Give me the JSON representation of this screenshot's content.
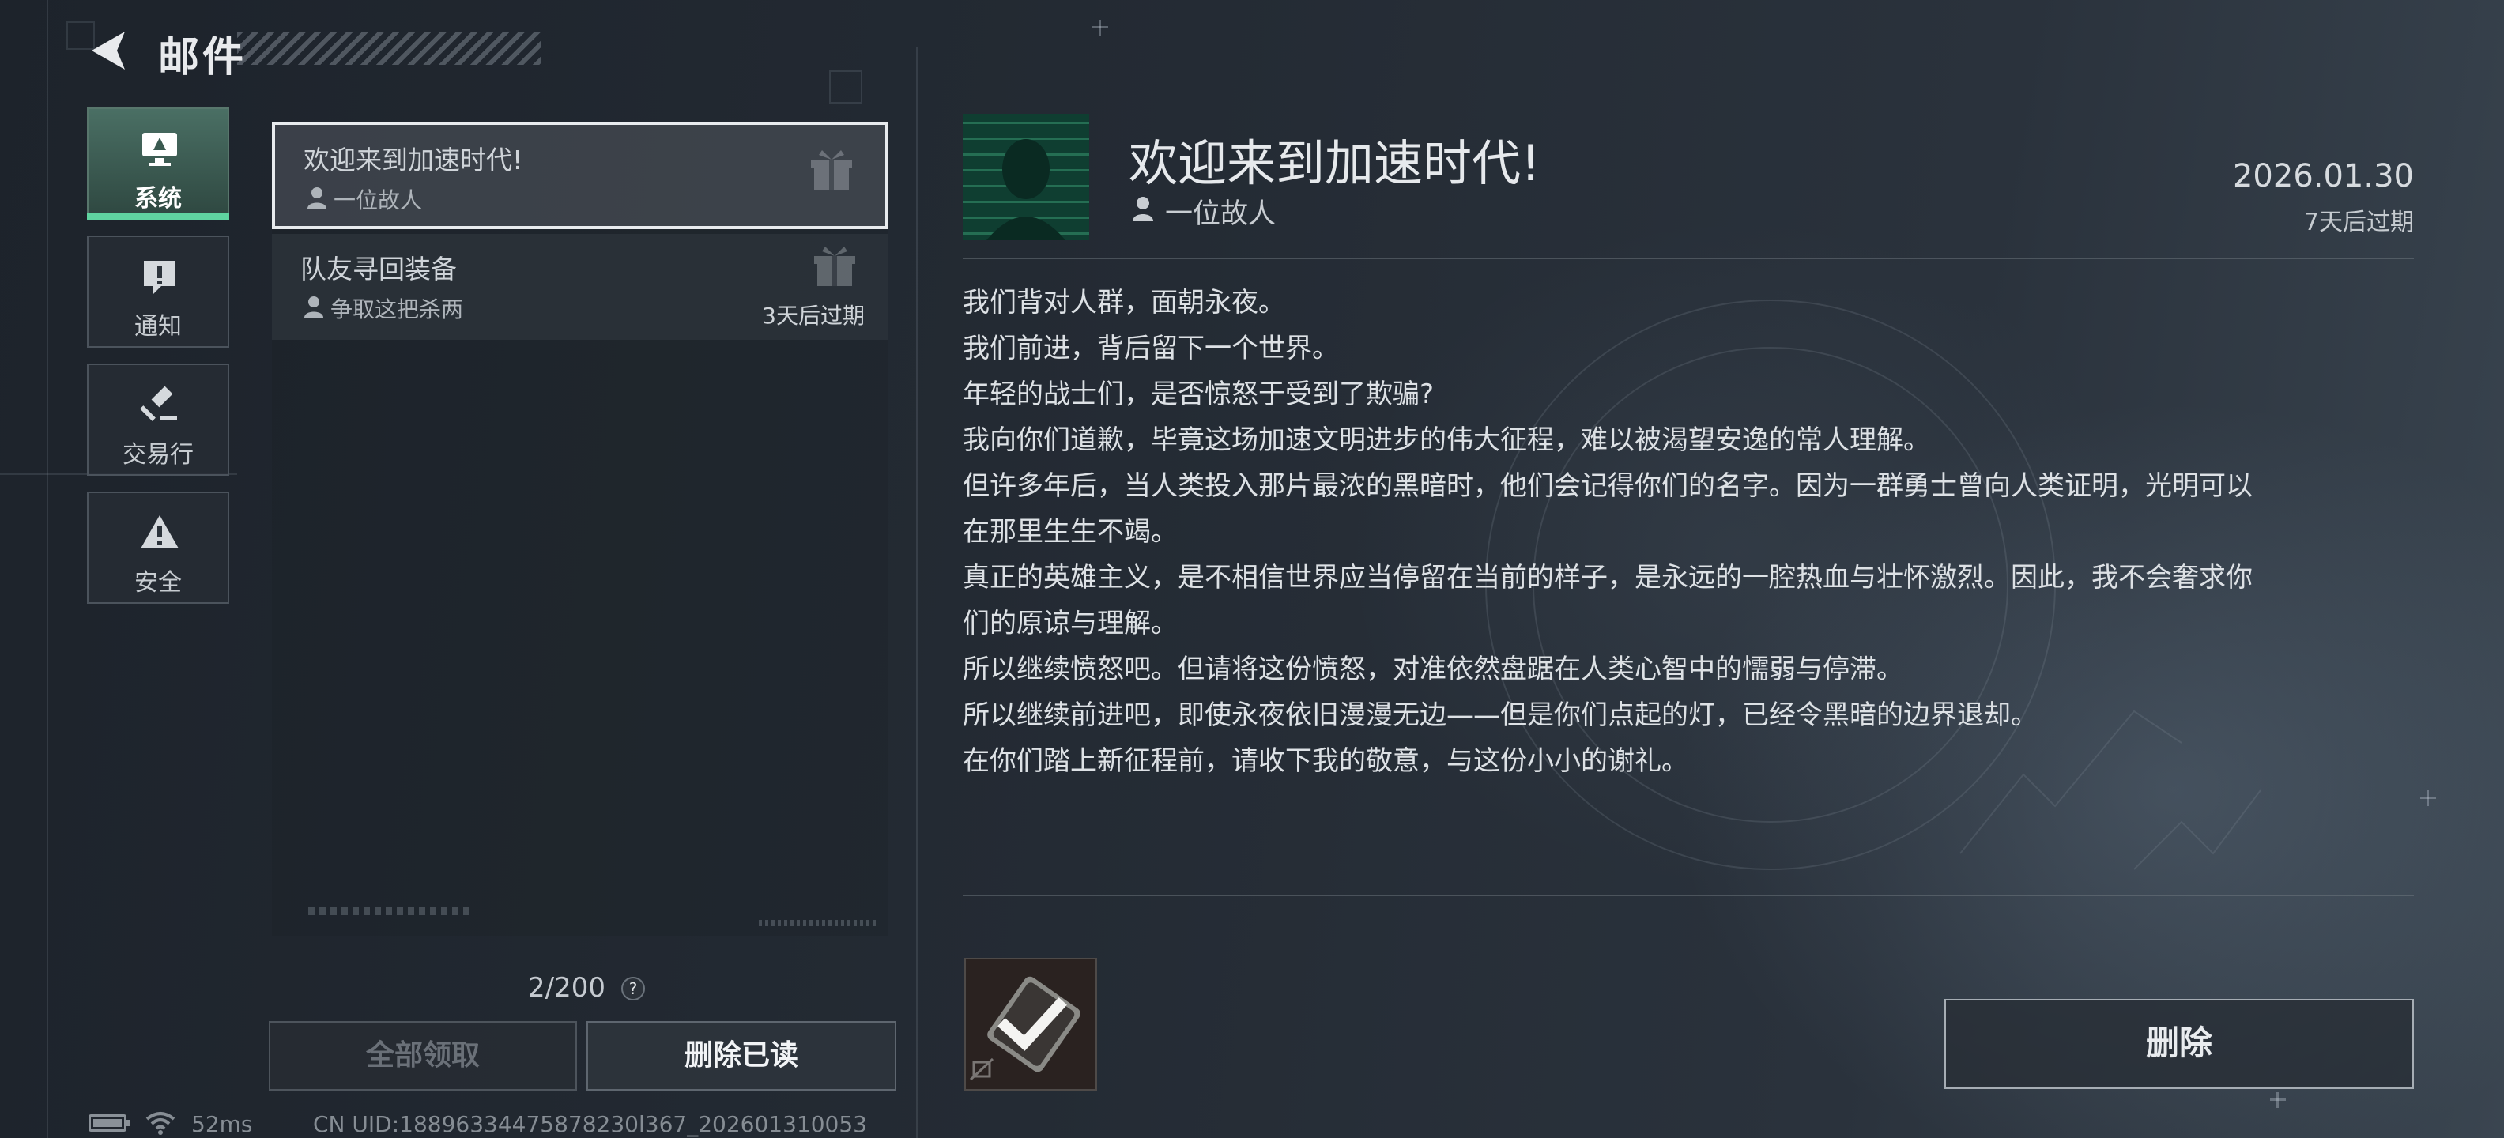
{
  "header": {
    "title": "邮件"
  },
  "tabs": [
    {
      "label": "系统",
      "icon": "monitor-icon",
      "active": true
    },
    {
      "label": "通知",
      "icon": "notice-icon",
      "active": false
    },
    {
      "label": "交易行",
      "icon": "gavel-icon",
      "active": false
    },
    {
      "label": "安全",
      "icon": "warning-icon",
      "active": false
    }
  ],
  "mail_list": [
    {
      "subject": "欢迎来到加速时代!",
      "sender": "一位故人",
      "expire": "",
      "selected": true
    },
    {
      "subject": "队友寻回装备",
      "sender": "争取这把杀两",
      "expire": "3天后过期",
      "selected": false
    }
  ],
  "list_footer": {
    "count": "2/200",
    "help": "?",
    "claim_all": "全部领取",
    "delete_read": "删除已读"
  },
  "status": {
    "ping": "52ms",
    "uid": "CN UID:18896334475878230l367_202601310053"
  },
  "detail": {
    "title": "欢迎来到加速时代!",
    "sender": "一位故人",
    "date": "2026.01.30",
    "expire": "7天后过期",
    "body": [
      "我们背对人群，面朝永夜。",
      "我们前进，背后留下一个世界。",
      "年轻的战士们，是否惊怒于受到了欺骗?",
      "我向你们道歉，毕竟这场加速文明进步的伟大征程，难以被渴望安逸的常人理解。",
      "但许多年后，当人类投入那片最浓的黑暗时，他们会记得你们的名字。因为一群勇士曾向人类证明，光明可以",
      "在那里生生不竭。",
      "真正的英雄主义，是不相信世界应当停留在当前的样子，是永远的一腔热血与壮怀激烈。因此，我不会奢求你",
      "们的原谅与理解。",
      "所以继续愤怒吧。但请将这份愤怒，对准依然盘踞在人类心智中的懦弱与停滞。",
      "所以继续前进吧，即使永夜依旧漫漫无边——但是你们点起的灯，已经令黑暗的边界退却。",
      "在你们踏上新征程前，请收下我的敬意，与这份小小的谢礼。"
    ],
    "delete": "删除"
  },
  "colors": {
    "accent": "#5fd4a0",
    "background": "#242b34"
  }
}
